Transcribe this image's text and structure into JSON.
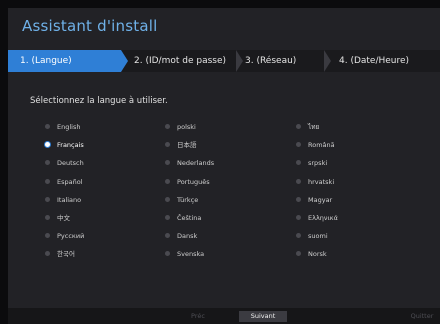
{
  "window": {
    "title": "Assistant d'install"
  },
  "steps": [
    "1.  (Langue)",
    "2.  (ID/mot de passe)",
    "3.  (Réseau)",
    "4.  (Date/Heure)"
  ],
  "prompt": "Sélectionnez la langue à utiliser.",
  "languages": [
    {
      "label": "English",
      "selected": false
    },
    {
      "label": "polski",
      "selected": false
    },
    {
      "label": "ไทย",
      "selected": false
    },
    {
      "label": "Français",
      "selected": true
    },
    {
      "label": "日本語",
      "selected": false
    },
    {
      "label": "Română",
      "selected": false
    },
    {
      "label": "Deutsch",
      "selected": false
    },
    {
      "label": "Nederlands",
      "selected": false
    },
    {
      "label": "srpski",
      "selected": false
    },
    {
      "label": "Español",
      "selected": false
    },
    {
      "label": "Português",
      "selected": false
    },
    {
      "label": "hrvatski",
      "selected": false
    },
    {
      "label": "Italiano",
      "selected": false
    },
    {
      "label": "Türkçe",
      "selected": false
    },
    {
      "label": "Magyar",
      "selected": false
    },
    {
      "label": "中文",
      "selected": false
    },
    {
      "label": "Čeština",
      "selected": false
    },
    {
      "label": "Ελληνικά",
      "selected": false
    },
    {
      "label": "Русский",
      "selected": false
    },
    {
      "label": "Dansk",
      "selected": false
    },
    {
      "label": "suomi",
      "selected": false
    },
    {
      "label": "한국어",
      "selected": false
    },
    {
      "label": "Svenska",
      "selected": false
    },
    {
      "label": "Norsk",
      "selected": false
    }
  ],
  "buttons": {
    "prec": "Préc",
    "next": "Suivant",
    "quit": "Quitter"
  },
  "colors": {
    "accent": "#2f7fd6",
    "title": "#6fb1e8",
    "background": "#222226"
  }
}
